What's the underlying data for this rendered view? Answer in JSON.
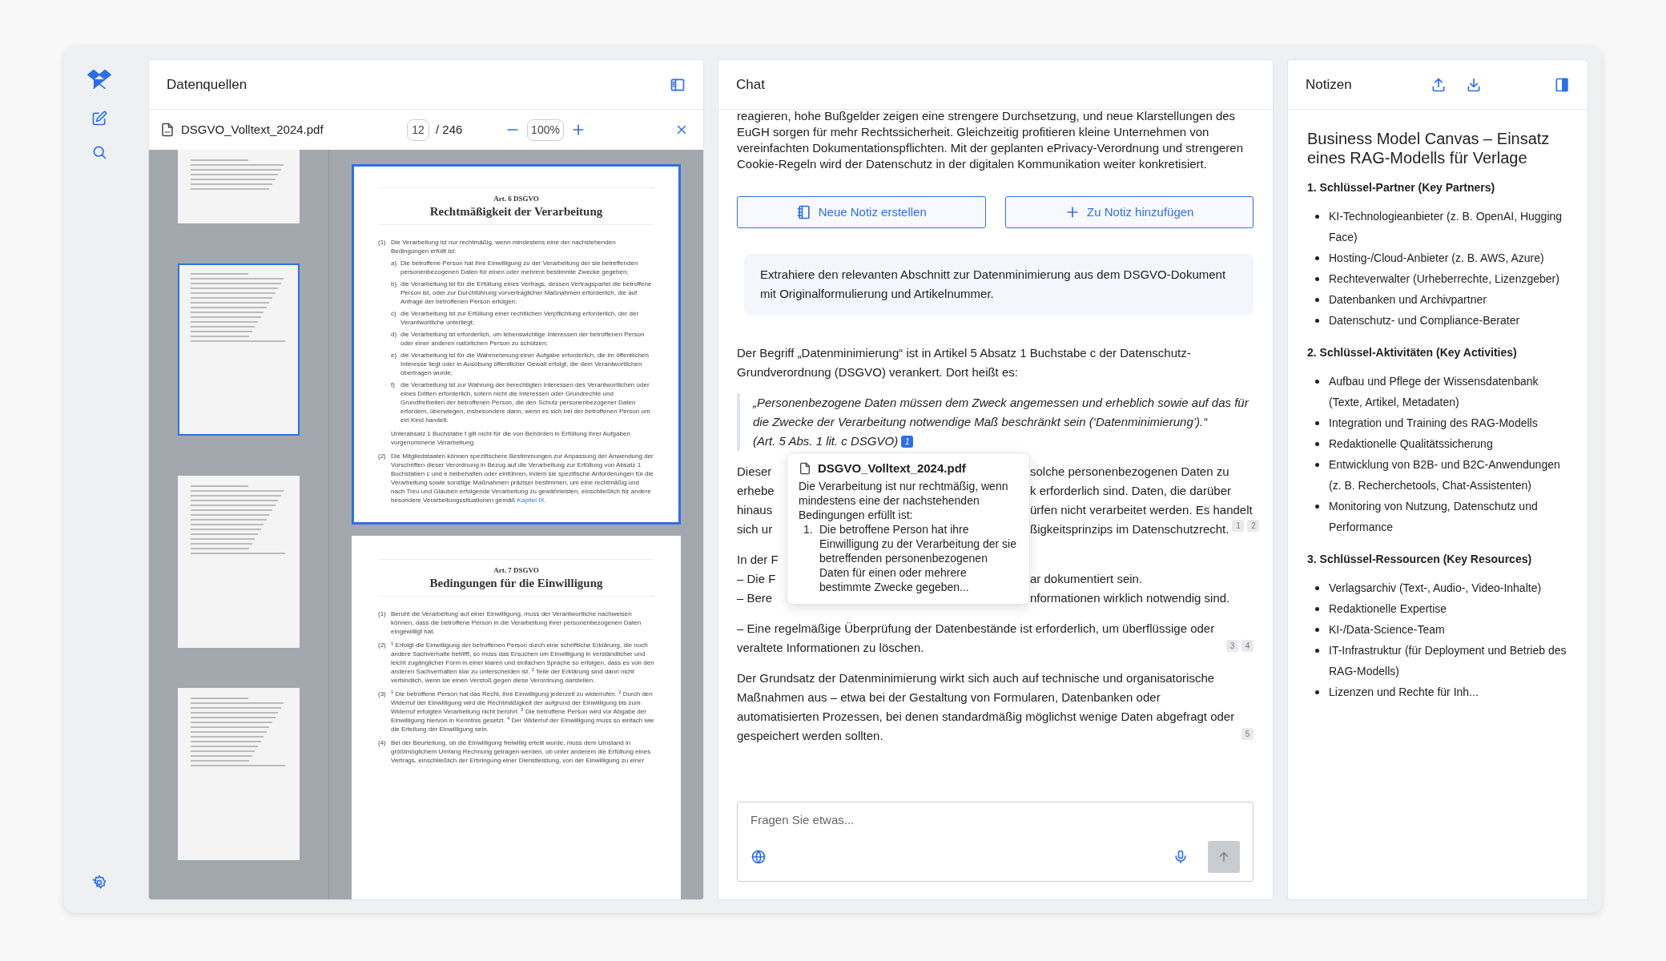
{
  "rail": {
    "items": [
      {
        "kind": "logo"
      },
      {
        "kind": "edit"
      },
      {
        "kind": "search"
      }
    ],
    "bottom": [
      {
        "kind": "settings"
      }
    ]
  },
  "sources": {
    "title": "Datenquellen",
    "file": "DSGVO_Volltext_2024.pdf",
    "page": "12",
    "page_total": "/ 246",
    "zoom": "100%",
    "thumbnails": [
      {
        "selected": false
      },
      {
        "selected": true
      },
      {
        "selected": false
      },
      {
        "selected": false
      }
    ],
    "pages": [
      {
        "selected": true,
        "label": "Art. 6 DSGVO",
        "title": "Rechtmäßigkeit der Verarbeitung",
        "paragraphs": [
          {
            "num": "(1)",
            "text": "Die Verarbeitung ist nur rechtmäßig, wenn mindestens eine der nachstehenden Bedingungen erfüllt ist:",
            "items": [
              {
                "marker": "a)",
                "text": "Die betroffene Person hat ihre Einwilligung zu der Verarbeitung der sie betreffenden personenbezogenen Daten für einen oder mehrere bestimmte Zwecke gegeben;"
              },
              {
                "marker": "b)",
                "text": "die Verarbeitung ist für die Erfüllung eines Vertrags, dessen Vertragspartei die betroffene Person ist, oder zur Durchführung vorvertraglicher Maßnahmen erforderlich, die auf Anfrage der betroffenen Person erfolgen;"
              },
              {
                "marker": "c)",
                "text": "die Verarbeitung ist zur Erfüllung einer rechtlichen Verpflichtung erforderlich, der der Verantwortliche unterliegt;"
              },
              {
                "marker": "d)",
                "text": "die Verarbeitung ist erforderlich, um lebenswichtige Interessen der betroffenen Person oder einer anderen natürlichen Person zu schützen;"
              },
              {
                "marker": "e)",
                "text": "die Verarbeitung ist für die Wahrnehmung einer Aufgabe erforderlich, die im öffentlichen Interesse liegt oder in Ausübung öffentlicher Gewalt erfolgt, die dem Verantwortlichen übertragen wurde;"
              },
              {
                "marker": "f)",
                "text": "die Verarbeitung ist zur Wahrung der berechtigten Interessen des Verantwortlichen oder eines Dritten erforderlich, sofern nicht die Interessen oder Grundrechte und Grundfreiheiten der betroffenen Person, die den Schutz personenbezogener Daten erfordern, überwiegen, insbesondere dann, wenn es sich bei der betroffenen Person um ein Kind handelt."
              }
            ],
            "note": "Unterabsatz 1 Buchstabe f gilt nicht für die von Behörden in Erfüllung ihrer Aufgaben vorgenommene Verarbeitung."
          },
          {
            "num": "(2)",
            "text": "Die Mitgliedstaaten können spezifischere Bestimmungen zur Anpassung der Anwendung der Vorschriften dieser Verordnung in Bezug auf die Verarbeitung zur Erfüllung von Absatz 1 Buchstaben c und e beibehalten oder einführen, indem sie spezifische Anforderungen für die Verarbeitung sowie sonstige Maßnahmen präziser bestimmen, um eine rechtmäßig und nach Treu und Glauben erfolgende Verarbeitung zu gewährleisten, einschließlich für andere besondere Verarbeitungssituationen gemäß",
            "link": "Kapitel IX",
            "end": "."
          }
        ]
      },
      {
        "selected": false,
        "label": "Art. 7 DSGVO",
        "title": "Bedingungen für die Einwilligung",
        "paragraphs": [
          {
            "num": "(1)",
            "text": "Beruht die Verarbeitung auf einer Einwilligung, muss der Verantwortliche nachweisen können, dass die betroffene Person in die Verarbeitung ihrer personenbezogenen Daten eingewilligt hat."
          },
          {
            "num": "(2)",
            "text": "$^{1}$ Erfolgt die Einwilligung der betroffenen Person durch eine schriftliche Erklärung, die noch andere Sachverhalte betrifft, so muss das Ersuchen um Einwilligung in verständlicher und leicht zugänglicher Form in einer klaren und einfachen Sprache so erfolgen, dass es von den anderen Sachverhalten klar zu unterscheiden ist. $^{2}$ Teile der Erklärung sind dann nicht verbindlich, wenn sie einen Verstoß gegen diese Verordnung darstellen."
          },
          {
            "num": "(3)",
            "text": "$^{1}$ Die betroffene Person hat das Recht, ihre Einwilligung jederzeit zu widerrufen. $^{2}$ Durch den Widerruf der Einwilligung wird die Rechtmäßigkeit der aufgrund der Einwilligung bis zum Widerruf erfolgten Verarbeitung nicht berührt. $^{3}$ Die betroffene Person wird vor Abgabe der Einwilligung hiervon in Kenntnis gesetzt. $^{4}$ Der Widerruf der Einwilligung muss so einfach wie die Erteilung der Einwilligung sein."
          },
          {
            "num": "(4)",
            "text": "Bei der Beurteilung, ob die Einwilligung freiwillig erteilt wurde, muss dem Umstand in größtmöglichem Umfang Rechnung getragen werden, ob unter anderem die Erfüllung eines Vertrags, einschließlich der Erbringung einer Dienstleistung, von der Einwilligung zu einer"
          }
        ]
      }
    ]
  },
  "chat": {
    "title": "Chat",
    "blocks": [
      {
        "kind": "text",
        "text": "reagieren, hohe Bußgelder zeigen eine strengere Durchsetzung, und neue Klarstellungen des EuGH sorgen für mehr Rechtssicherheit. Gleichzeitig profitieren kleine Unternehmen von vereinfachten Dokumentationspflichten. Mit der geplanten ePrivacy-Verordnung und strengeren Cookie-Regeln wird der Datenschutz in der digitalen Kommunikation weiter konkretisiert."
      },
      {
        "kind": "actions",
        "buttons": [
          {
            "label": "Neue Notiz erstellen"
          },
          {
            "label": "Zu Notiz hinzufügen"
          }
        ]
      },
      {
        "kind": "user",
        "text": "Extrahiere den relevanten Abschnitt zur Datenminimierung aus dem DSGVO-Dokument mit Originalformulierung und Artikelnummer."
      },
      {
        "kind": "text",
        "text": "Der Begriff „Datenminimierung“ ist in Artikel 5 Absatz 1 Buchstabe c der Datenschutz-Grundverordnung (DSGVO) verankert. Dort heißt es:"
      },
      {
        "kind": "quote",
        "text": "„Personenbezogene Daten müssen dem Zweck angemessen und erheblich sowie auf das für die Zwecke der Verarbeitung notwendige Maß beschränkt sein (‘Datenminimierung’).“",
        "source": "(Art. 5 Abs. 1 lit. c DSGVO)",
        "citations": [
          {
            "label": "1",
            "selected": true
          }
        ]
      },
      {
        "kind": "occluded",
        "paragraphs": [
          {
            "lines": [
              {
                "left": "Dieser",
                "right": "solche personenbezogenen Daten zu"
              },
              {
                "left": "erhebe",
                "right": "k erforderlich sind. Daten, die darüber"
              },
              {
                "left": "hinaus",
                "right": "ürfen nicht verarbeitet werden. Es handelt"
              },
              {
                "left": "sich ur",
                "right": "ßigkeitsprinzips im Datenschutzrecht.",
                "citations": [
                  {
                    "label": "1",
                    "selected": false
                  },
                  {
                    "label": "2",
                    "selected": false
                  }
                ]
              }
            ]
          },
          {
            "lines": [
              {
                "left": "In der F"
              },
              {
                "left": "– Die F",
                "right": "ar dokumentiert sein."
              },
              {
                "left": "– Bere",
                "right": "nformationen wirklich notwendig sind."
              }
            ]
          }
        ],
        "popover": {
          "file": "DSGVO_Volltext_2024.pdf",
          "text": "Die Verarbeitung ist nur rechtmäßig, wenn mindestens eine der nachstehenden Bedingungen erfüllt ist:",
          "items": [
            {
              "marker": "1.",
              "text": "Die betroffene Person hat ihre Einwilligung zu der Verarbeitung der sie betreffenden personenbezogenen Daten für einen oder mehrere bestimmte Zwecke gegeben..."
            }
          ]
        }
      },
      {
        "kind": "text",
        "text": "– Eine regelmäßige Überprüfung der Datenbestände ist erforderlich, um überflüssige oder veraltete Informationen zu löschen.",
        "citations": [
          {
            "label": "3",
            "selected": false
          },
          {
            "label": "4",
            "selected": false
          }
        ]
      },
      {
        "kind": "text",
        "text": "Der Grundsatz der Datenminimierung wirkt sich auch auf technische und organisatorische Maßnahmen aus – etwa bei der Gestaltung von Formularen, Datenbanken oder automatisierten Prozessen, bei denen standardmäßig möglichst wenige Daten abgefragt oder gespeichert werden sollten.",
        "citations": [
          {
            "label": "5",
            "selected": false
          }
        ]
      }
    ],
    "input": {
      "placeholder": "Fragen Sie etwas...",
      "send_disabled": true
    }
  },
  "notes": {
    "title": "Notizen",
    "heading": "Business Model Canvas – Einsatz eines RAG-Modells für Verlage",
    "sections": [
      {
        "title": "1. Schlüssel-Partner (Key Partners)",
        "items": [
          "KI-Technologieanbieter (z. B. OpenAI, Hugging Face)",
          "Hosting-/Cloud-Anbieter (z. B. AWS, Azure)",
          "Rechteverwalter (Urheberrechte, Lizenzgeber)",
          "Datenbanken und Archivpartner",
          "Datenschutz- und Compliance-Berater"
        ]
      },
      {
        "title": "2. Schlüssel-Aktivitäten (Key Activities)",
        "items": [
          "Aufbau und Pflege der Wissensdatenbank (Texte, Artikel, Metadaten)",
          "Integration und Training des RAG-Modells",
          "Redaktionelle Qualitätssicherung",
          "Entwicklung von B2B- und B2C-Anwendungen (z. B. Recherchetools, Chat-Assistenten)",
          "Monitoring von Nutzung, Datenschutz und Performance"
        ]
      },
      {
        "title": "3. Schlüssel-Ressourcen (Key Resources)",
        "items": [
          "Verlagsarchiv (Text-, Audio-, Video-Inhalte)",
          "Redaktionelle Expertise",
          "KI-/Data-Science-Team",
          "IT-Infrastruktur (für Deployment und Betrieb des RAG-Modells)",
          "Lizenzen und Rechte für Inh..."
        ]
      }
    ]
  }
}
